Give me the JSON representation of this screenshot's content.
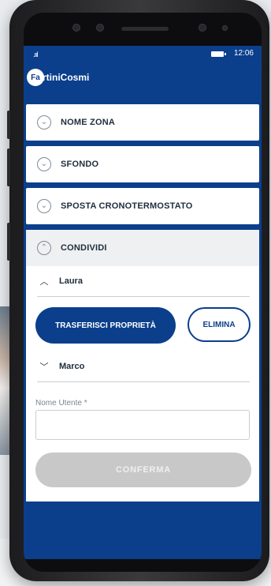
{
  "status": {
    "signal": ".ııl",
    "time": "12:06"
  },
  "brand": {
    "badge": "Fa",
    "name": "rtiniCosmi"
  },
  "menu": [
    {
      "label": "NOME ZONA",
      "icon": "chevron-down-icon"
    },
    {
      "label": "SFONDO",
      "icon": "chevron-down-icon"
    },
    {
      "label": "SPOSTA CRONOTERMOSTATO",
      "icon": "chevron-down-icon"
    }
  ],
  "share": {
    "label": "CONDIVIDI",
    "icon": "chevron-up-icon",
    "users": [
      {
        "name": "Laura",
        "expanded": true
      },
      {
        "name": "Marco",
        "expanded": false
      }
    ],
    "transfer_label": "TRASFERISCI PROPRIETÀ",
    "delete_label": "ELIMINA",
    "username_label": "Nome Utente *",
    "username_value": "",
    "confirm_label": "CONFERMA"
  },
  "colors": {
    "brand": "#0b3f8c",
    "disabled": "#c8c8c8"
  }
}
